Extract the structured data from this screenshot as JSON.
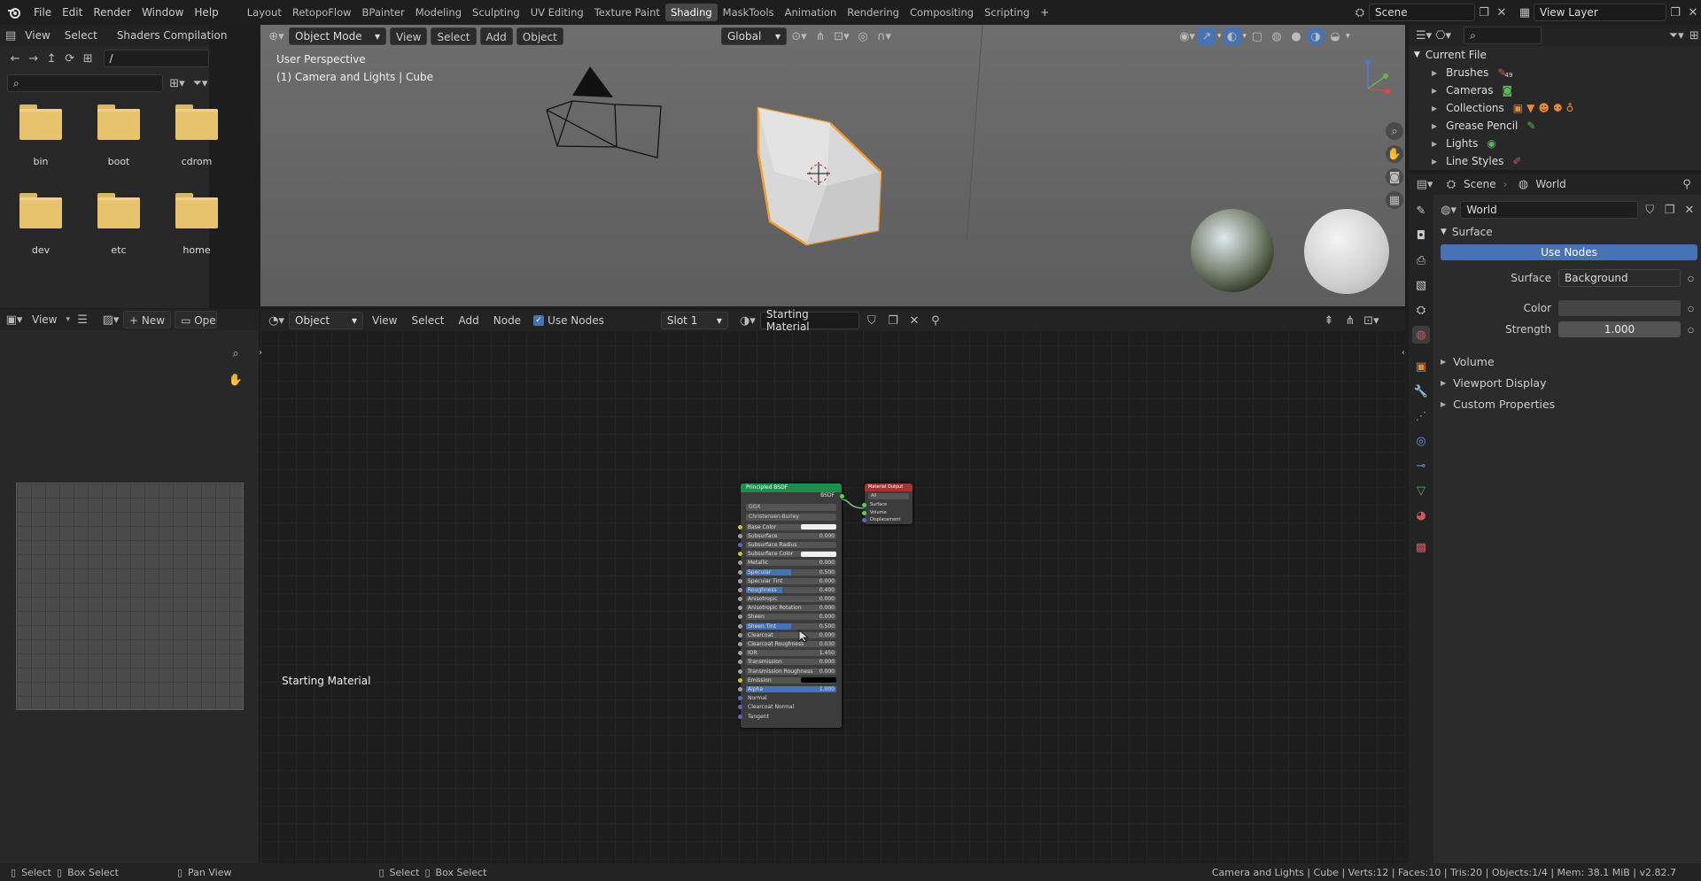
{
  "topbar": {
    "menus": [
      "File",
      "Edit",
      "Render",
      "Window",
      "Help"
    ],
    "workspaces": [
      "Layout",
      "RetopoFlow",
      "BPainter",
      "Modeling",
      "Sculpting",
      "UV Editing",
      "Texture Paint",
      "Shading",
      "MaskTools",
      "Animation",
      "Rendering",
      "Compositing",
      "Scripting"
    ],
    "active_workspace": "Shading",
    "add_tab": "+",
    "scene": "Scene",
    "view_layer": "View Layer"
  },
  "filebrowser": {
    "menus": [
      "View",
      "Select"
    ],
    "shader_compilation": "Shaders Compilation",
    "path": "/",
    "folders": [
      "bin",
      "boot",
      "cdrom",
      "dev",
      "etc",
      "home"
    ]
  },
  "viewport": {
    "mode": "Object Mode",
    "menus": [
      "View",
      "Select",
      "Add",
      "Object"
    ],
    "transform": "Global",
    "perspective": "User Perspective",
    "context": "(1) Camera and Lights | Cube"
  },
  "image_editor": {
    "view": "View",
    "new": "New",
    "open": "Open"
  },
  "node_editor": {
    "object": "Object",
    "menus": [
      "View",
      "Select",
      "Add",
      "Node"
    ],
    "use_nodes": "Use Nodes",
    "slot": "Slot 1",
    "material": "Starting Material",
    "footer_label": "Starting Material",
    "bsdf": {
      "title": "Principled BSDF",
      "out": "BSDF",
      "dist": "GGX",
      "sss": "Christensen-Burley",
      "rows": [
        [
          "Base Color",
          "",
          false
        ],
        [
          "Subsurface",
          "0.000",
          false
        ],
        [
          "Subsurface Radius",
          "",
          false
        ],
        [
          "Subsurface Color",
          "",
          false
        ],
        [
          "Metallic",
          "0.000",
          false
        ],
        [
          "Specular",
          "0.500",
          true
        ],
        [
          "Specular Tint",
          "0.000",
          false
        ],
        [
          "Roughness",
          "0.400",
          true
        ],
        [
          "Anisotropic",
          "0.000",
          false
        ],
        [
          "Anisotropic Rotation",
          "0.000",
          false
        ],
        [
          "Sheen",
          "0.000",
          false
        ],
        [
          "Sheen Tint",
          "0.500",
          true
        ],
        [
          "Clearcoat",
          "0.000",
          false
        ],
        [
          "Clearcoat Roughness",
          "0.030",
          false
        ],
        [
          "IOR",
          "1.450",
          false
        ],
        [
          "Transmission",
          "0.000",
          false
        ],
        [
          "Transmission Roughness",
          "0.000",
          false
        ],
        [
          "Emission",
          "",
          false
        ],
        [
          "Alpha",
          "1.000",
          true
        ],
        [
          "Normal",
          "",
          false
        ],
        [
          "Clearcoat Normal",
          "",
          false
        ],
        [
          "Tangent",
          "",
          false
        ]
      ]
    },
    "output": {
      "title": "Material Output",
      "target": "All",
      "rows": [
        "Surface",
        "Volume",
        "Displacement"
      ]
    }
  },
  "outliner": {
    "root": "Current File",
    "items": [
      "Brushes",
      "Cameras",
      "Collections",
      "Grease Pencil",
      "Lights",
      "Line Styles"
    ],
    "brush_count": "49"
  },
  "properties": {
    "scene": "Scene",
    "world": "World",
    "world_name": "World",
    "surface_section": "Surface",
    "use_nodes": "Use Nodes",
    "surface_label": "Surface",
    "surface_value": "Background",
    "color_label": "Color",
    "strength_label": "Strength",
    "strength_value": "1.000",
    "sections": [
      "Volume",
      "Viewport Display",
      "Custom Properties"
    ]
  },
  "statusbar": {
    "select": "Select",
    "box_select": "Box Select",
    "pan_view": "Pan View",
    "select2": "Select",
    "box_select2": "Box Select",
    "info": "Camera and Lights | Cube | Verts:12 | Faces:10 | Tris:20 | Objects:1/4 | Mem: 38.1 MiB | v2.82.7"
  },
  "colors": {
    "accent": "#4772b3",
    "bsdf_header": "#1a8f4c",
    "output_header": "#a83232",
    "selection": "#f29c2b"
  }
}
